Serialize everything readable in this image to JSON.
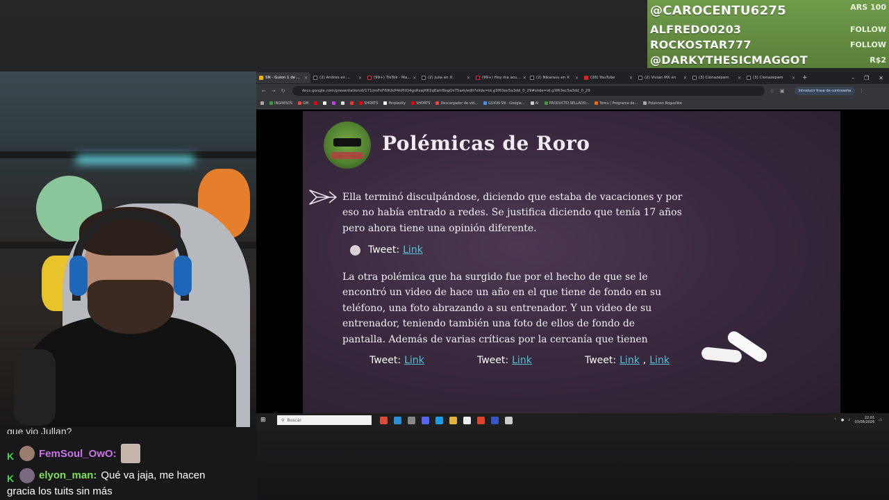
{
  "overlay": {
    "alerts": [
      {
        "name": "@CAROCENTU6275",
        "tag": "ARS 100"
      },
      {
        "name": "ALFREDO0203",
        "tag": "FOLLOW"
      },
      {
        "name": "ROCKOSTAR777",
        "tag": "FOLLOW"
      },
      {
        "name": "@DARKYTHESICMAGGOT",
        "tag": "R$2"
      }
    ],
    "accent": "#6f9b4a"
  },
  "chat": {
    "cut_text": "que vio Jullan?",
    "messages": [
      {
        "user": "FemSoul_OwO:",
        "text": ""
      },
      {
        "user": "elyon_man:",
        "text": "Qué va jaja, me hacen",
        "cont": "gracia los tuits sin más"
      }
    ]
  },
  "browser": {
    "tabs": [
      "SN - Guion 1 de ...",
      "(2) Andres en ...",
      "(99+) TikTok - Ma...",
      "(2) julia en X:",
      "(99+) Hoy me acu...",
      "(2) Nikarasu en X",
      "(28) YouTube",
      "(2) Vivian MX en",
      "(3) Clonazepam",
      "(3) Clonazepam"
    ],
    "url": "docs.google.com/presentation/d/171zmFoF69UkP4kPItQ4gsRsajHK2qEahf9sgOsT5ark/edit?slide=id.g3f63ec5a3dd_0_29#slide=id.g3f63ec5a3dd_0_29",
    "password_button": "Introducir frase de contraseña",
    "bookmarks": [
      "INGRESOS",
      "GM",
      "SHORTS",
      "Perplexity",
      "SHORTS",
      "Descargador de víd...",
      "GUION SN - Google...",
      "AI",
      "PRODUCTO SELLADO...",
      "Temu | Programa de...",
      "Pokemon Roguelike"
    ]
  },
  "slide": {
    "title": "Polémicas de Roro",
    "paragraph1": "Ella terminó disculpándose, diciendo que estaba de vacaciones y por eso no había entrado a redes. Se justifica diciendo que tenía 17 años pero ahora tiene una opinión diferente.",
    "tweet_label": "Tweet:",
    "link_label": "Link",
    "paragraph2": "La otra polémica que ha surgido fue por el hecho de que se le encontró un video de hace un año en el que tiene de fondo en su teléfono, una foto abrazando a su entrenador. Y un video de su entrenador, teniendo también una foto de ellos de fondo de pantalla. Además de varias críticas por la cercanía que tienen",
    "link_sep": ","
  },
  "taskbar": {
    "search_placeholder": "Buscar",
    "time": "22:01",
    "date": "03/08/2026"
  }
}
